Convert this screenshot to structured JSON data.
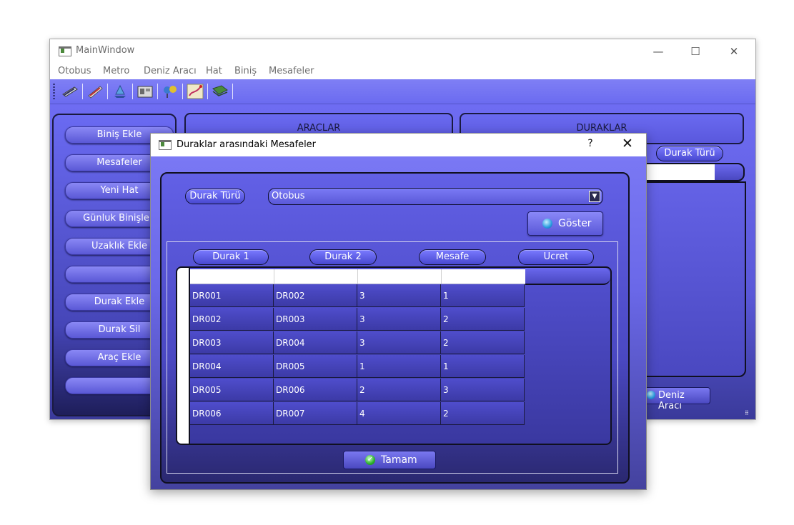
{
  "main_window": {
    "title": "MainWindow",
    "menu": [
      "Otobus",
      "Metro",
      "Deniz Aracı",
      "Hat",
      "Biniş",
      "Mesafeler"
    ],
    "toolbar_icons": [
      "train-icon",
      "rail-icon",
      "ship-icon",
      "building-icon",
      "map-pin-icon",
      "route-icon",
      "card-icon"
    ],
    "sidebar_buttons": [
      "Biniş Ekle",
      "Mesafeler",
      "Yeni Hat",
      "Günluk Binişleri",
      "Uzaklık Ekle",
      "",
      "Durak Ekle",
      "Durak Sil",
      "Araç Ekle",
      ""
    ],
    "araclar_header": "ARACLAR",
    "duraklar_header": "DURAKLAR",
    "durak_turu_label": "Durak Türü",
    "deniz_araci_label": "Deniz Aracı"
  },
  "dialog": {
    "title": "Duraklar arasındaki Mesafeler",
    "help_glyph": "?",
    "close_glyph": "✕",
    "durak_turu_label": "Durak Türü",
    "durak_turu_value": "Otobus",
    "goster_label": "Göster",
    "columns": [
      "Durak 1",
      "Durak 2",
      "Mesafe",
      "Ucret"
    ],
    "rows": [
      [
        "DR001",
        "DR002",
        "3",
        "1"
      ],
      [
        "DR002",
        "DR003",
        "3",
        "2"
      ],
      [
        "DR003",
        "DR004",
        "3",
        "2"
      ],
      [
        "DR004",
        "DR005",
        "1",
        "1"
      ],
      [
        "DR005",
        "DR006",
        "2",
        "3"
      ],
      [
        "DR006",
        "DR007",
        "4",
        "2"
      ]
    ],
    "tamam_label": "Tamam"
  },
  "colors": {
    "accent": "#6b6bf0",
    "panel_dark": "#1a1a40"
  }
}
